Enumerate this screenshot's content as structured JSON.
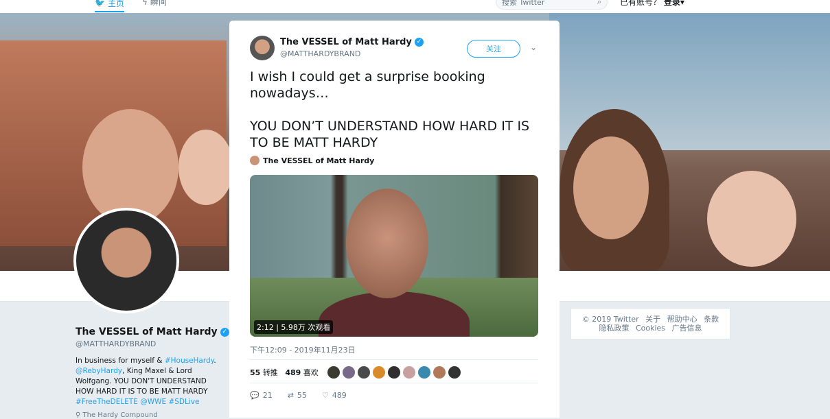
{
  "topbar": {
    "home_label": "主页",
    "moments_label": "瞬间",
    "search_placeholder": "搜索 Twitter",
    "login_prompt": "已有账号？",
    "login_label": "登录"
  },
  "profile": {
    "name": "The VESSEL of Matt Hardy",
    "handle": "@MATTHARDYBRAND",
    "bio": [
      {
        "t": "In business for myself & ",
        "link": false
      },
      {
        "t": "#HouseHardy",
        "link": true
      },
      {
        "t": ". ",
        "link": false
      },
      {
        "t": "@RebyHardy",
        "link": true
      },
      {
        "t": ", King Maxel & Lord Wolfgang. YOU DON'T UNDERSTAND HOW HARD IT IS TO BE MATT HARDY ",
        "link": false
      },
      {
        "t": "#FreeTheDELETE",
        "link": true
      },
      {
        "t": " ",
        "link": false
      },
      {
        "t": "@WWE",
        "link": true
      },
      {
        "t": " ",
        "link": false
      },
      {
        "t": "#SDLive",
        "link": true
      }
    ],
    "more_text": "The Hardy Compound"
  },
  "footer": {
    "copyright": "© 2019 Twitter",
    "about": "关于",
    "help": "帮助中心",
    "terms": "条款",
    "privacy": "隐私政策",
    "cookies": "Cookies",
    "ads": "广告信息"
  },
  "tweet": {
    "author_name": "The VESSEL of Matt Hardy",
    "author_handle": "@MATTHARDYBRAND",
    "follow_label": "关注",
    "text": "I wish I could get a surprise booking nowadays…\n\nYOU DON’T UNDERSTAND HOW HARD IT IS TO BE MATT HARDY",
    "attribution": "The VESSEL of Matt Hardy",
    "video_badge": "2:12 | 5.98万 次观看",
    "timestamp": "下午12:09 - 2019年11月23日",
    "retweet_count": "55",
    "retweet_label": "转推",
    "like_count": "489",
    "like_label": "喜欢",
    "actions": {
      "replies": "21",
      "retweets": "55",
      "likes": "489"
    },
    "liker_colors": [
      "#3b3b2f",
      "#7a6a8a",
      "#4a4a4a",
      "#d98b2b",
      "#2f2f2f",
      "#c9a0a0",
      "#3a8ab0",
      "#b07a5a",
      "#333333"
    ]
  },
  "colors": {
    "accent": "#1da1f2",
    "muted": "#657786",
    "background": "#e6ecf0"
  }
}
